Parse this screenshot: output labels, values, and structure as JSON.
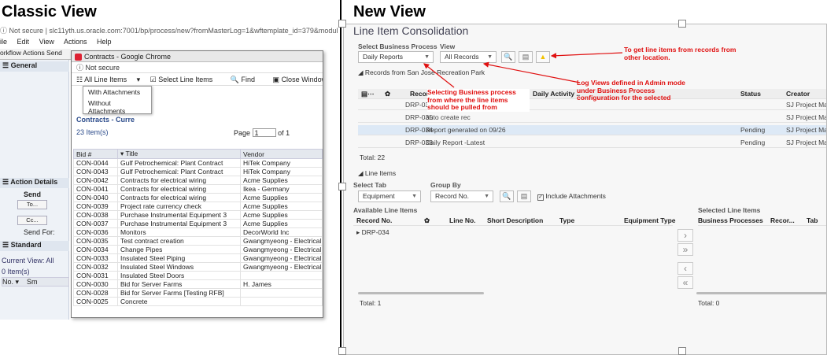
{
  "headings": {
    "classic": "Classic View",
    "new": "New View"
  },
  "classic": {
    "url_prefix": "Not secure",
    "url": "slc11yth.us.oracle.com:7001/bp/process/new?fromMasterLog=1&wftemplate_id=379&modul",
    "menu": [
      "ile",
      "Edit",
      "View",
      "Actions",
      "Help"
    ],
    "tabs": "orkflow Actions  Send",
    "general_label": "General",
    "action_details_label": "Action Details",
    "send_label": "Send",
    "to_btn": "To...",
    "cc_btn": "Cc...",
    "send_for": "Send For:",
    "standard_label": "Standard",
    "current_view": "Current View:  All",
    "items_count": "0  Item(s)",
    "col_no": "No.",
    "col_sm": "Sm",
    "popup": {
      "title": "Contracts - Google Chrome",
      "not_secure": "Not secure",
      "toolbar": [
        "All Line Items",
        "Select Line Items",
        "Find",
        "Close Window"
      ],
      "dropdown": [
        "With Attachments",
        "Without Attachments"
      ],
      "contracts_label": "Contracts - Curre",
      "items": "23  Item(s)",
      "page_label": "Page",
      "page_value": "1",
      "page_of": "of  1",
      "columns": [
        "Bid #",
        "Title",
        "Vendor"
      ],
      "rows": [
        [
          "CON-0044",
          "Gulf Petrochemical: Plant Contract",
          "HiTek Company"
        ],
        [
          "CON-0043",
          "Gulf Petrochemical: Plant Contract",
          "HiTek Company"
        ],
        [
          "CON-0042",
          "Contracts for electrical wiring",
          "Acme Supplies"
        ],
        [
          "CON-0041",
          "Contracts for electrical wiring",
          "Ikea - Germany"
        ],
        [
          "CON-0040",
          "Contracts for electrical wiring",
          "Acme Supplies"
        ],
        [
          "CON-0039",
          "Project rate currency check",
          "Acme Supplies"
        ],
        [
          "CON-0038",
          "Purchase Instrumental Equipment 3",
          "Acme Supplies"
        ],
        [
          "CON-0037",
          "Purchase Instrumental Equipment 3",
          "Acme Supplies"
        ],
        [
          "CON-0036",
          "Monitors",
          "DecorWorld Inc"
        ],
        [
          "CON-0035",
          "Test contract creation",
          "Gwangmyeong - Electrical S"
        ],
        [
          "CON-0034",
          "Change Pipes",
          "Gwangmyeong - Electrical S"
        ],
        [
          "CON-0033",
          "Insulated Steel Piping",
          "Gwangmyeong - Electrical S"
        ],
        [
          "CON-0032",
          "Insulated Steel Windows",
          "Gwangmyeong - Electrical S"
        ],
        [
          "CON-0031",
          "Insulated Steel Doors",
          ""
        ],
        [
          "CON-0030",
          "Bid for Server Farms",
          "H. James"
        ],
        [
          "CON-0028",
          "Bid for Server Farms [Testing RFB]",
          ""
        ],
        [
          "CON-0025",
          "Concrete",
          ""
        ]
      ]
    }
  },
  "newview": {
    "title": "Line Item Consolidation",
    "select_bp_label": "Select Business Process",
    "view_label": "View",
    "bp_value": "Daily Reports",
    "view_value": "All Records",
    "records_from": "Records from San Jose Recreation Park",
    "cols": [
      "Record #",
      "Daily Activity ..",
      "Status",
      "Creator"
    ],
    "rows": [
      {
        "rec": "DRP-03",
        "title": "",
        "status": "",
        "creator": "SJ Project Ma."
      },
      {
        "rec": "DRP-035",
        "title": "auto create rec",
        "status": "",
        "creator": "SJ Project Ma."
      },
      {
        "rec": "DRP-034",
        "title": "Report generated on 09/26",
        "status": "Pending",
        "creator": "SJ Project Ma."
      },
      {
        "rec": "DRP-033",
        "title": "Daily Report -Latest",
        "status": "Pending",
        "creator": "SJ Project Ma."
      }
    ],
    "total_top": "Total: 22",
    "line_items_label": "Line Items",
    "select_tab_label": "Select Tab",
    "group_by_label": "Group By",
    "tab_value": "Equipment",
    "group_value": "Record No.",
    "include_attachments": "Include Attachments",
    "available_label": "Available Line Items",
    "selected_label": "Selected Line Items",
    "avail_cols": [
      "Record No.",
      "Line No.",
      "Short Description",
      "Type",
      "Equipment Type"
    ],
    "sel_cols": [
      "Business Processes",
      "Recor...",
      "Tab"
    ],
    "avail_row": "DRP-034",
    "total_left": "Total: 1",
    "total_right": "Total: 0",
    "annotations": {
      "other_location": "To get line items from records from other location.",
      "select_bp": "Selecting Business process from where the line items should be pulled from",
      "log_views": "Log Views defined in Admin mode under Business Process configuration for the selected"
    }
  },
  "colors": {
    "annotation": "#e01010",
    "warning_icon": "#f2c200"
  }
}
